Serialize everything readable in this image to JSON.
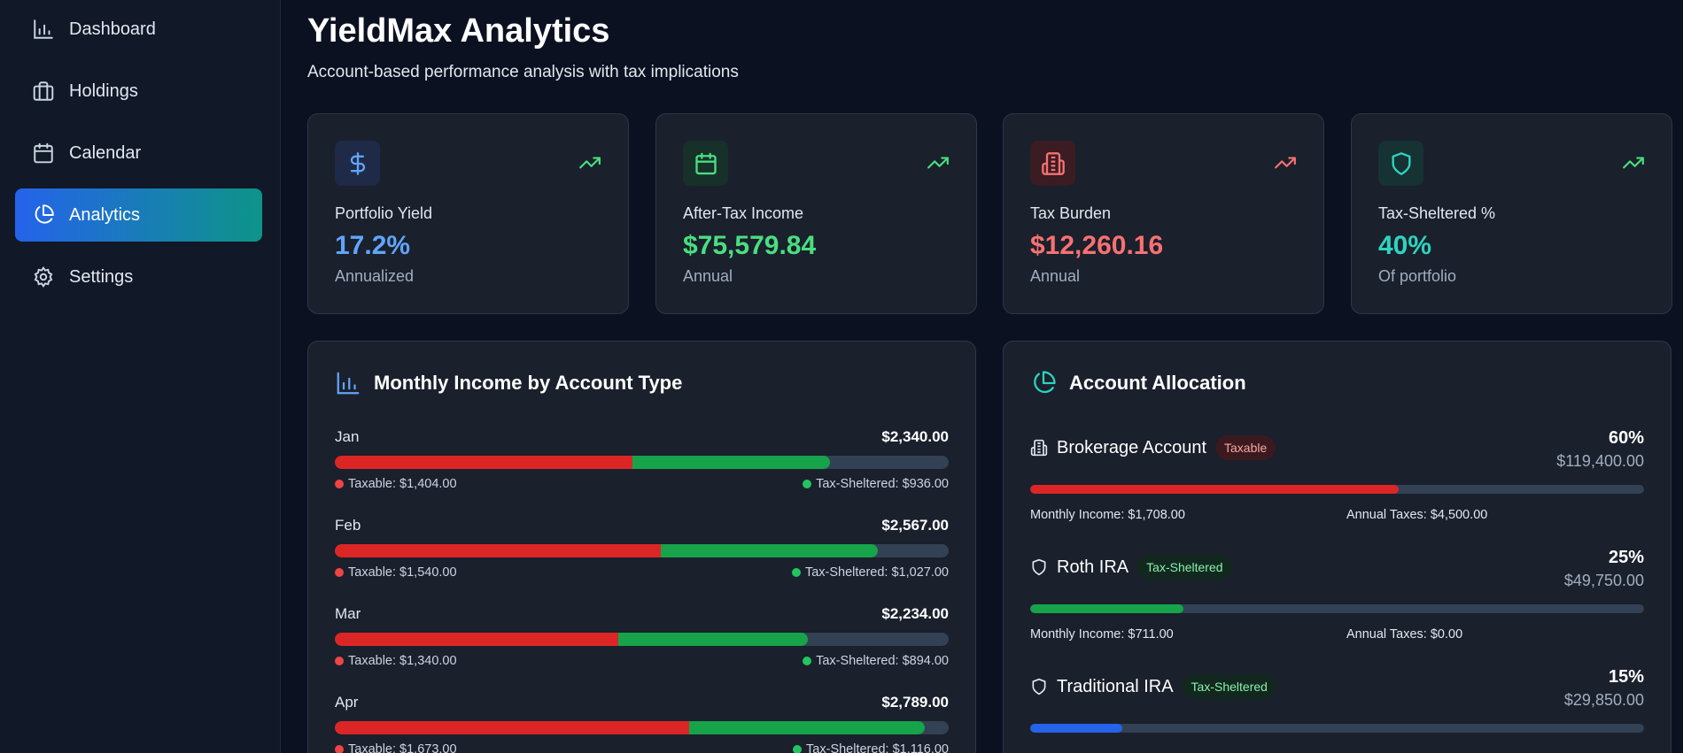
{
  "sidebar": {
    "items": [
      {
        "label": "Dashboard",
        "icon": "bar-chart-icon"
      },
      {
        "label": "Holdings",
        "icon": "briefcase-icon"
      },
      {
        "label": "Calendar",
        "icon": "calendar-icon"
      },
      {
        "label": "Analytics",
        "icon": "pie-chart-icon",
        "active": true
      },
      {
        "label": "Settings",
        "icon": "gear-icon"
      }
    ]
  },
  "header": {
    "title": "YieldMax Analytics",
    "subtitle": "Account-based performance analysis with tax implications"
  },
  "cards": [
    {
      "label": "Portfolio Yield",
      "value": "17.2%",
      "sub": "Annualized",
      "icon": "dollar-icon",
      "color": "#60a5fa"
    },
    {
      "label": "After-Tax Income",
      "value": "$75,579.84",
      "sub": "Annual",
      "icon": "calendar-icon",
      "color": "#4ade80"
    },
    {
      "label": "Tax Burden",
      "value": "$12,260.16",
      "sub": "Annual",
      "icon": "building-icon",
      "color": "#f87171"
    },
    {
      "label": "Tax-Sheltered %",
      "value": "40%",
      "sub": "Of portfolio",
      "icon": "shield-icon",
      "color": "#2dd4bf"
    }
  ],
  "monthly": {
    "title": "Monthly Income by Account Type",
    "months": [
      {
        "name": "Jan",
        "total": "$2,340.00",
        "taxable": "Taxable: $1,404.00",
        "sheltered": "Tax-Sheltered: $936.00",
        "taxable_value": 1404,
        "sheltered_value": 936
      },
      {
        "name": "Feb",
        "total": "$2,567.00",
        "taxable": "Taxable: $1,540.00",
        "sheltered": "Tax-Sheltered: $1,027.00",
        "taxable_value": 1540,
        "sheltered_value": 1027
      },
      {
        "name": "Mar",
        "total": "$2,234.00",
        "taxable": "Taxable: $1,340.00",
        "sheltered": "Tax-Sheltered: $894.00",
        "taxable_value": 1340,
        "sheltered_value": 894
      },
      {
        "name": "Apr",
        "total": "$2,789.00",
        "taxable": "Taxable: $1,673.00",
        "sheltered": "Tax-Sheltered: $1,116.00",
        "taxable_value": 1673,
        "sheltered_value": 1116
      }
    ],
    "scale_max": 2900
  },
  "allocation": {
    "title": "Account Allocation",
    "accounts": [
      {
        "name": "Brokerage Account",
        "badge": "Taxable",
        "badge_type": "taxable",
        "pct": "60%",
        "pct_value": 60,
        "amount": "$119,400.00",
        "monthly": "Monthly Income: $1,708.00",
        "taxes": "Annual Taxes: $4,500.00",
        "color": "#dc2626",
        "icon": "building-icon"
      },
      {
        "name": "Roth IRA",
        "badge": "Tax-Sheltered",
        "badge_type": "sheltered",
        "pct": "25%",
        "pct_value": 25,
        "amount": "$49,750.00",
        "monthly": "Monthly Income: $711.00",
        "taxes": "Annual Taxes: $0.00",
        "color": "#16a34a",
        "icon": "shield-icon"
      },
      {
        "name": "Traditional IRA",
        "badge": "Tax-Sheltered",
        "badge_type": "sheltered",
        "pct": "15%",
        "pct_value": 15,
        "amount": "$29,850.00",
        "monthly": "",
        "taxes": "",
        "color": "#2563eb",
        "icon": "shield-icon"
      }
    ]
  },
  "colors": {
    "red": "#f87171",
    "green": "#4ade80",
    "teal": "#2dd4bf",
    "blue": "#60a5fa"
  }
}
